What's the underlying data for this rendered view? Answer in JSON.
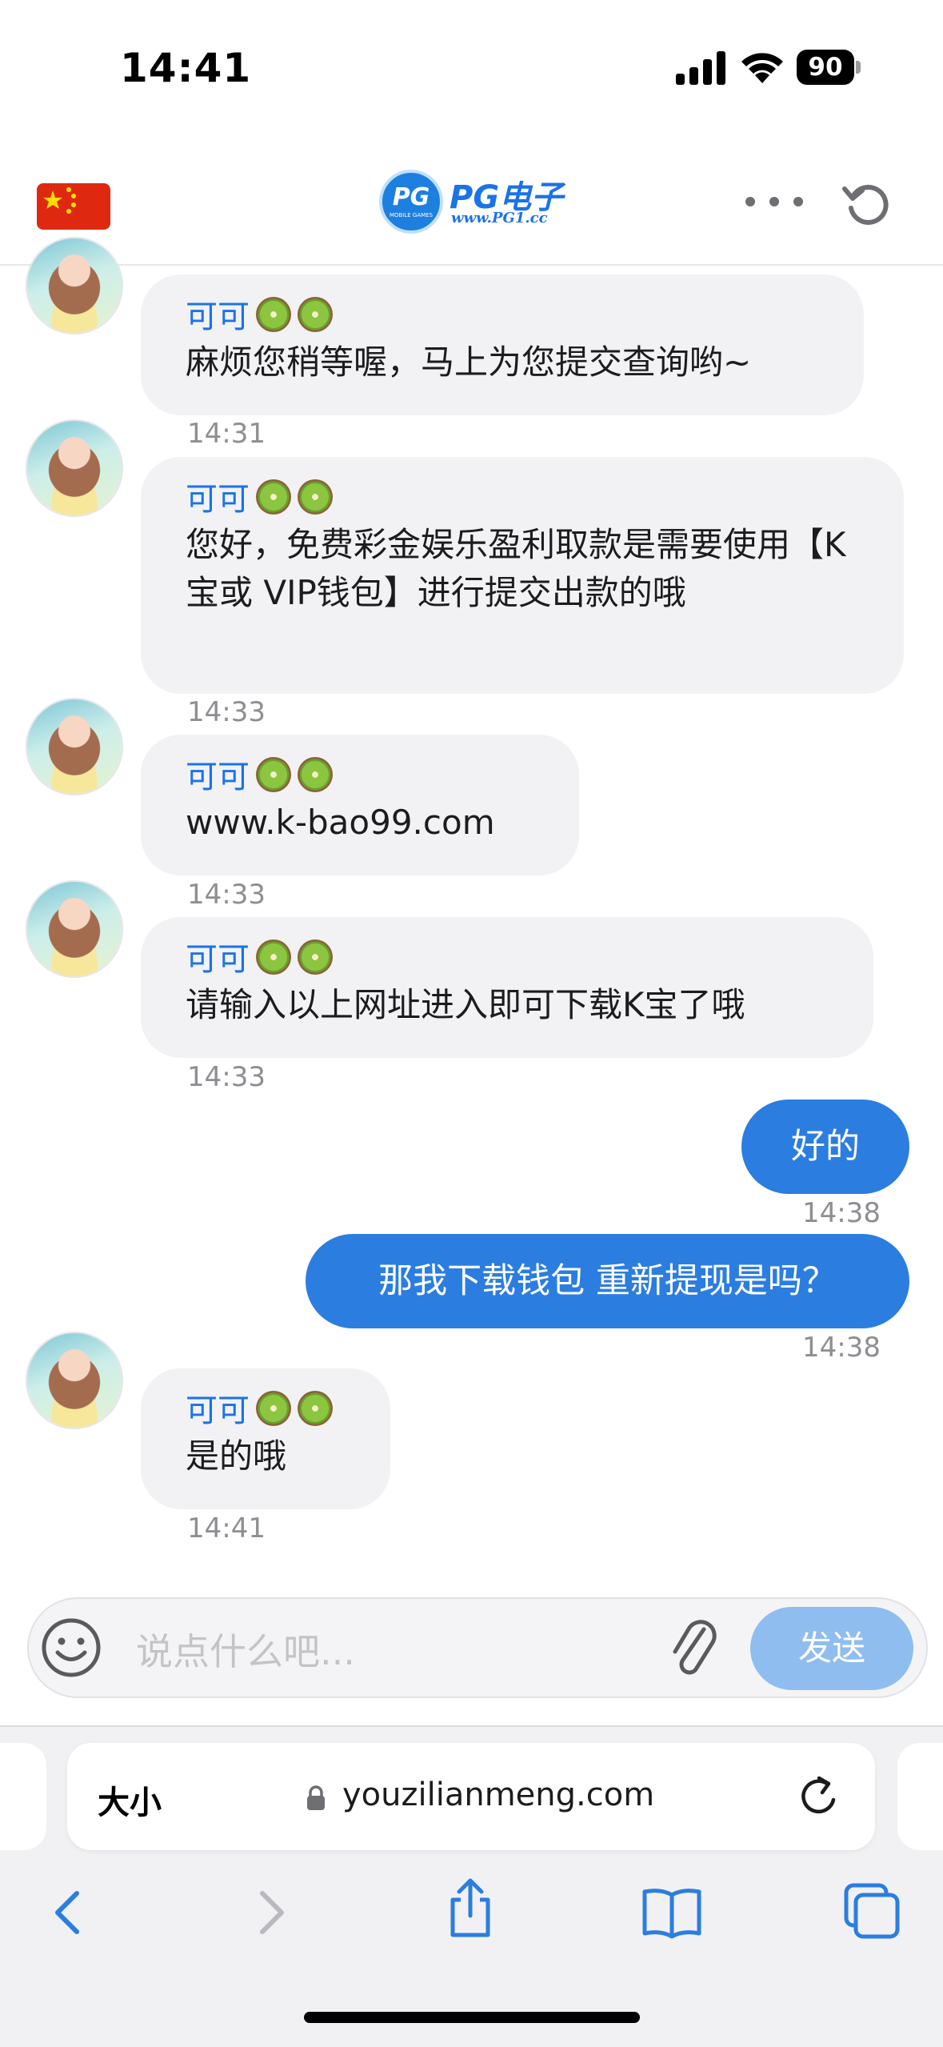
{
  "status_bar": {
    "time": "14:41",
    "battery": "90"
  },
  "header": {
    "logo_text": "PG",
    "logo_small": "MOBILE GAMES",
    "title": "PG电子",
    "url": "www.PG1.cc"
  },
  "messages": [
    {
      "sender": "可可",
      "text": "麻烦您稍等喔，马上为您提交查询哟~",
      "time": "14:31"
    },
    {
      "sender": "可可",
      "text": "您好，免费彩金娱乐盈利取款是需要使用【K宝或 VIP钱包】进行提交出款的哦",
      "time": "14:33"
    },
    {
      "sender": "可可",
      "text": "www.k-bao99.com",
      "time": "14:33"
    },
    {
      "sender": "可可",
      "text": "请输入以上网址进入即可下载K宝了哦",
      "time": "14:33"
    },
    {
      "text": "好的",
      "time": "14:38"
    },
    {
      "text": "那我下载钱包 重新提现是吗？",
      "time": "14:38"
    },
    {
      "sender": "可可",
      "text": "是的哦",
      "time": "14:41"
    }
  ],
  "input": {
    "placeholder": "说点什么吧...",
    "send_label": "发送"
  },
  "browser": {
    "size_label": "大小",
    "url": "youzilianmeng.com"
  },
  "colors": {
    "accent": "#2b7de0",
    "send_disabled": "#90bdf0",
    "bubble_in": "#f2f2f4"
  },
  "icons": [
    "china-flag-icon",
    "more-icon",
    "refresh-icon",
    "smile-icon",
    "paperclip-icon",
    "lock-icon",
    "reload-icon",
    "back-icon",
    "forward-icon",
    "share-icon",
    "bookmarks-icon",
    "tabs-icon"
  ]
}
